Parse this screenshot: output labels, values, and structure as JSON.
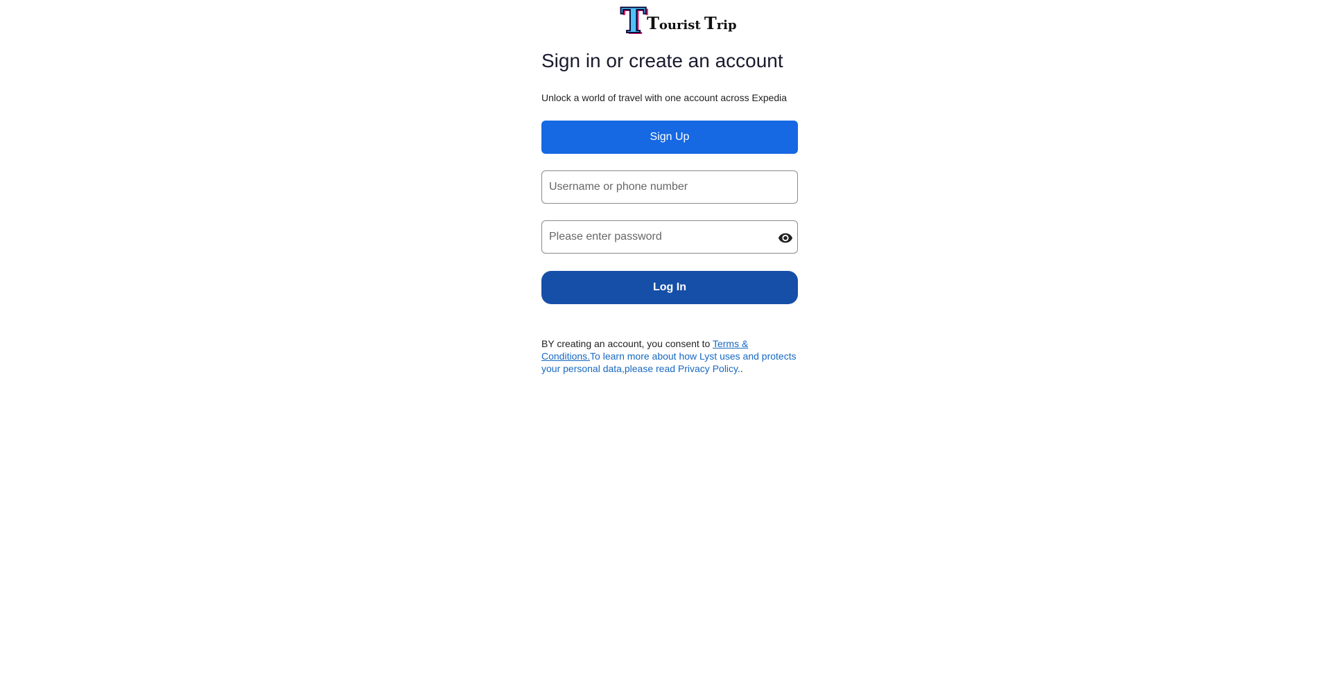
{
  "brand": {
    "logo_big_letter": "T",
    "logo_word_1_cap": "T",
    "logo_word_1_rest": "ourist",
    "logo_word_2_cap": "T",
    "logo_word_2_rest": "rip"
  },
  "header": {
    "title": "Sign in or create an account",
    "subtitle": "Unlock a world of travel with one account across Expedia"
  },
  "actions": {
    "signup_label": "Sign Up",
    "login_label": "Log In"
  },
  "form": {
    "username": {
      "value": "",
      "placeholder": "Username or phone number"
    },
    "password": {
      "value": "",
      "placeholder": "Please enter password"
    },
    "password_toggle_icon": "eye-icon"
  },
  "legal": {
    "prefix": "BY creating an account, you consent to ",
    "terms_link": "Terms & Conditions.",
    "middle": "To learn more about how Lyst uses and protects your personal data,please read Privacy Policy.",
    "suffix": "."
  },
  "colors": {
    "signup_button": "#1668e3",
    "login_button": "#164fa8",
    "link": "#1668c1"
  }
}
